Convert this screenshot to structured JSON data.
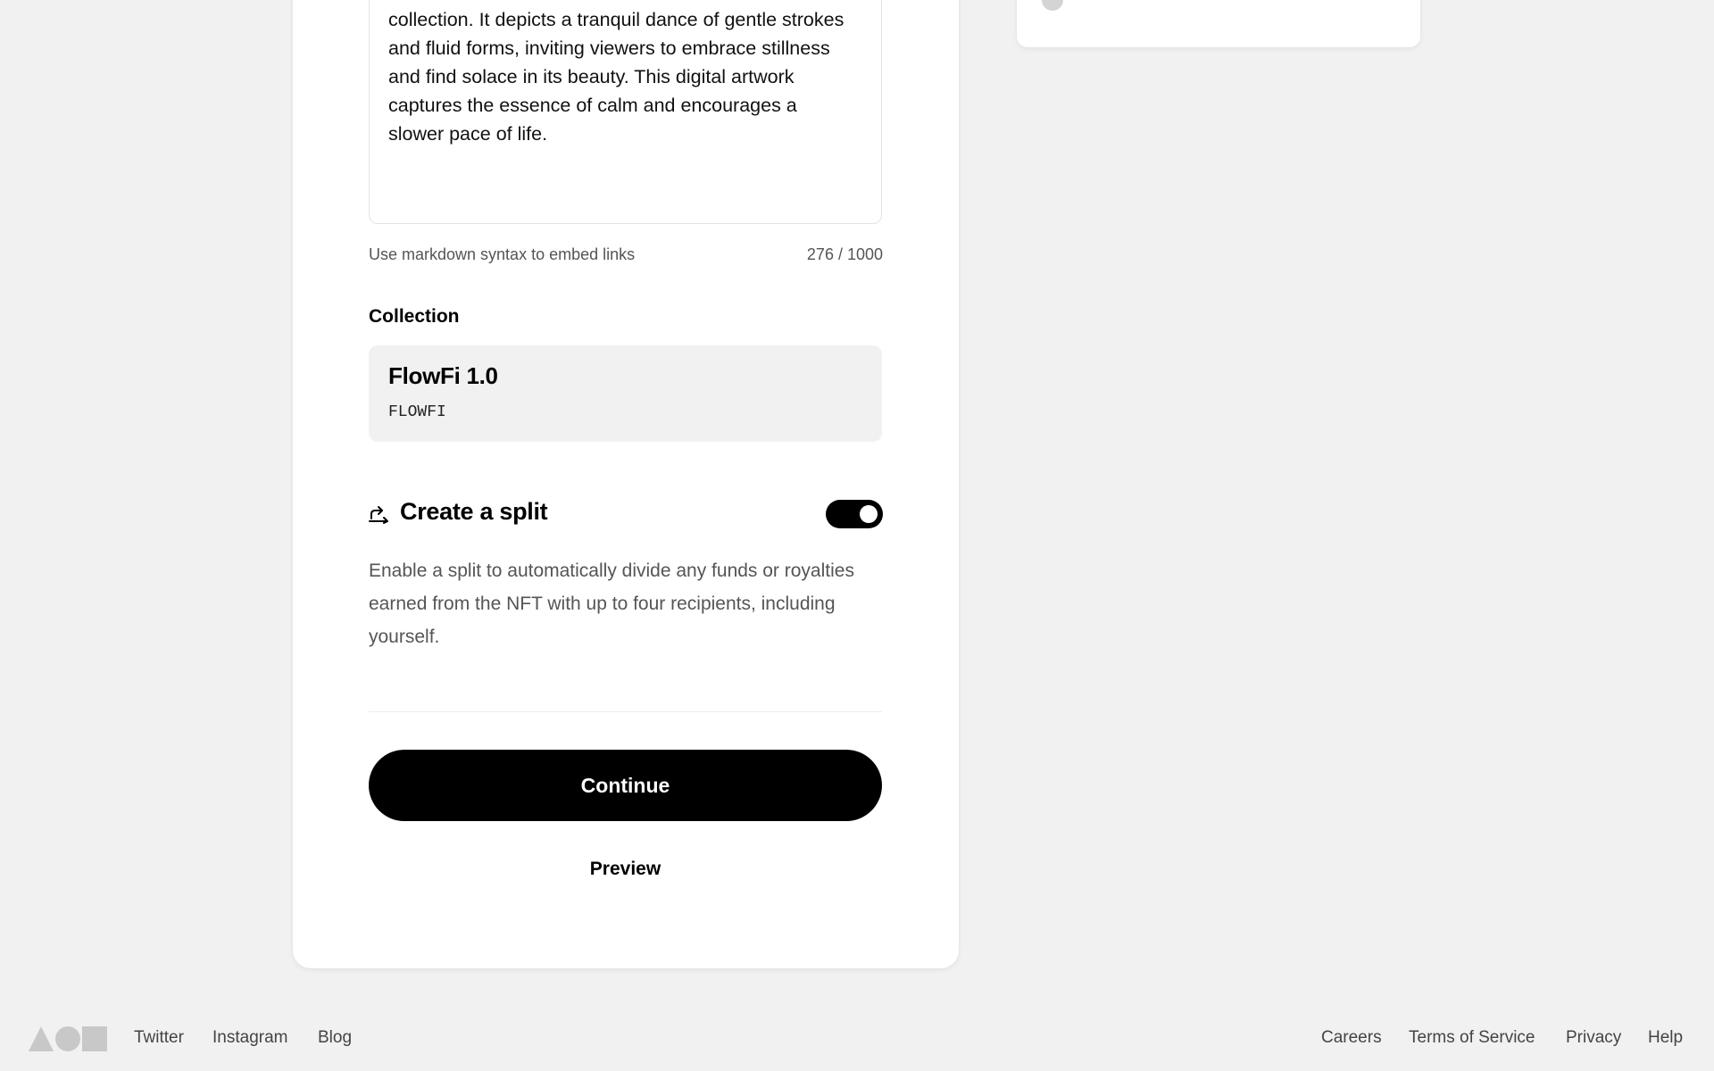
{
  "description": {
    "text": "collection. It depicts a tranquil dance of gentle strokes and fluid forms, inviting viewers to embrace stillness and find solace in its beauty. This digital artwork captures the essence of calm and encourages a slower pace of life.",
    "hint": "Use markdown syntax to embed links",
    "char_count": "276 / 1000"
  },
  "collection": {
    "label": "Collection",
    "name": "FlowFi 1.0",
    "symbol": "FLOWFI"
  },
  "split": {
    "icon": "split-arrow-icon",
    "title": "Create a split",
    "enabled": true,
    "description": "Enable a split to automatically divide any funds or royalties earned from the NFT with up to four recipients, including yourself."
  },
  "actions": {
    "continue_label": "Continue",
    "preview_label": "Preview"
  },
  "footer": {
    "left_links": [
      "Twitter",
      "Instagram",
      "Blog"
    ],
    "right_links": [
      "Careers",
      "Terms of Service",
      "Privacy",
      "Help"
    ]
  }
}
